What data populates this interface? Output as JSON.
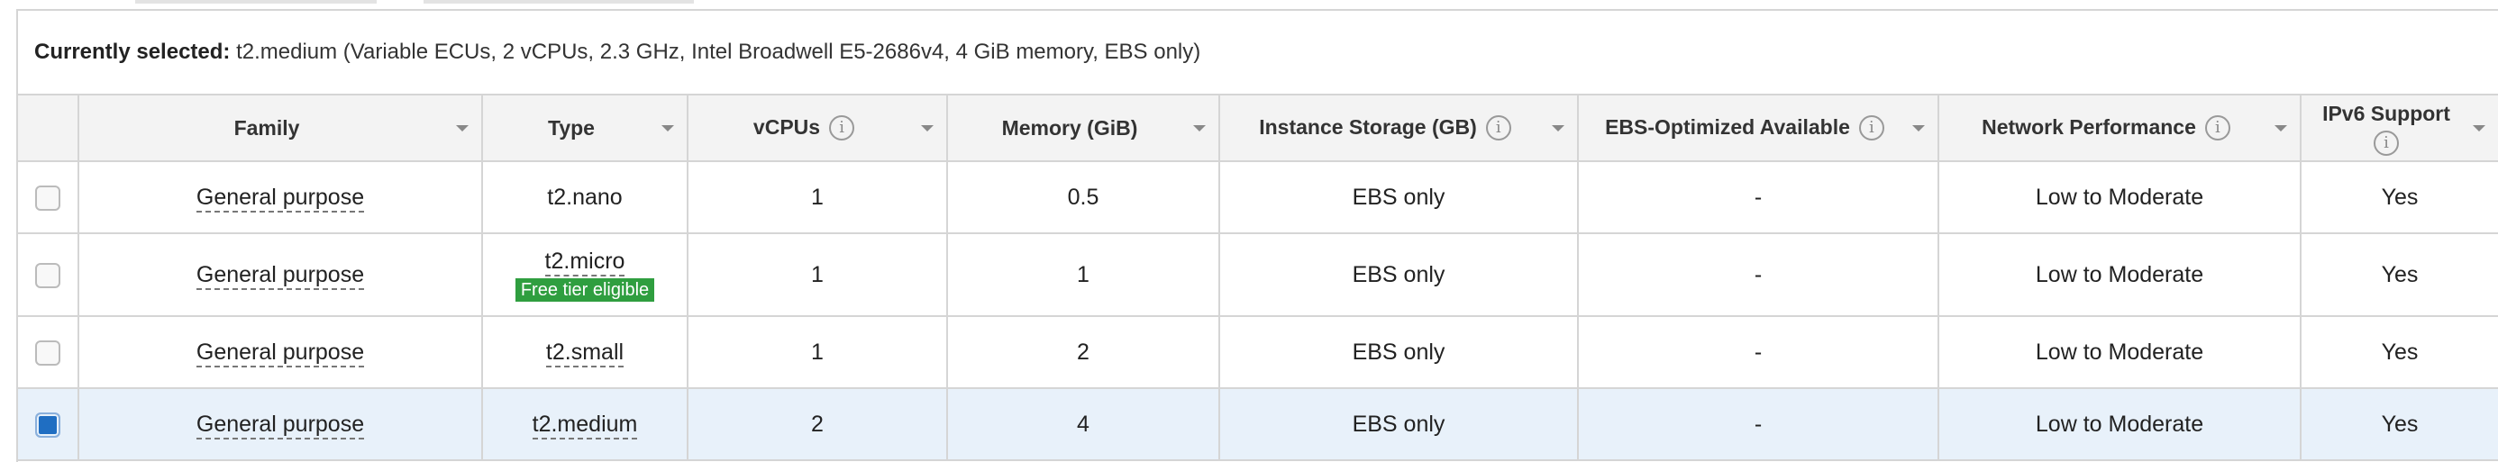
{
  "selection": {
    "label": "Currently selected:",
    "value": " t2.medium (Variable ECUs, 2 vCPUs, 2.3 GHz, Intel Broadwell E5-2686v4, 4 GiB memory, EBS only)"
  },
  "table": {
    "columns": {
      "family": "Family",
      "type": "Type",
      "vcpus": "vCPUs",
      "memory": "Memory (GiB)",
      "storage": "Instance Storage (GB)",
      "ebs": "EBS-Optimized Available",
      "network": "Network Performance",
      "ipv6": "IPv6 Support"
    },
    "rows": [
      {
        "checked": false,
        "family": "General purpose",
        "type": "t2.nano",
        "badge": "",
        "vcpus": "1",
        "memory": "0.5",
        "storage": "EBS only",
        "ebs": "-",
        "network": "Low to Moderate",
        "ipv6": "Yes"
      },
      {
        "checked": false,
        "family": "General purpose",
        "type": "t2.micro",
        "badge": "Free tier eligible",
        "vcpus": "1",
        "memory": "1",
        "storage": "EBS only",
        "ebs": "-",
        "network": "Low to Moderate",
        "ipv6": "Yes"
      },
      {
        "checked": false,
        "family": "General purpose",
        "type": "t2.small",
        "badge": "",
        "vcpus": "1",
        "memory": "2",
        "storage": "EBS only",
        "ebs": "-",
        "network": "Low to Moderate",
        "ipv6": "Yes"
      },
      {
        "checked": true,
        "family": "General purpose",
        "type": "t2.medium",
        "badge": "",
        "vcpus": "2",
        "memory": "4",
        "storage": "EBS only",
        "ebs": "-",
        "network": "Low to Moderate",
        "ipv6": "Yes"
      }
    ]
  },
  "icons": {
    "info": "info-icon",
    "sort": "sort-caret-icon"
  },
  "colors": {
    "selected_row": "#e8f1fa",
    "badge": "#2f9e3f",
    "checkbox_checked": "#1f6ec2"
  }
}
